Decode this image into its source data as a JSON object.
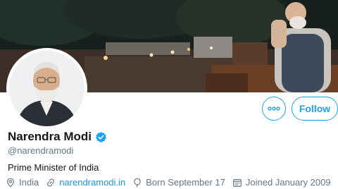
{
  "profile": {
    "name": "Narendra Modi",
    "handle": "@narendramodi",
    "bio": "Prime Minister of India",
    "location": "India",
    "website": "narendramodi.in",
    "birthday": "Born September 17",
    "joined": "Joined January 2009"
  },
  "actions": {
    "follow_label": "Follow"
  },
  "colors": {
    "accent": "#1da1f2",
    "link": "#1b95e0",
    "muted": "#657786",
    "text": "#14171a"
  },
  "icons": [
    "more-icon",
    "verified-badge-icon",
    "location-icon",
    "link-icon",
    "birthday-icon",
    "calendar-icon"
  ]
}
